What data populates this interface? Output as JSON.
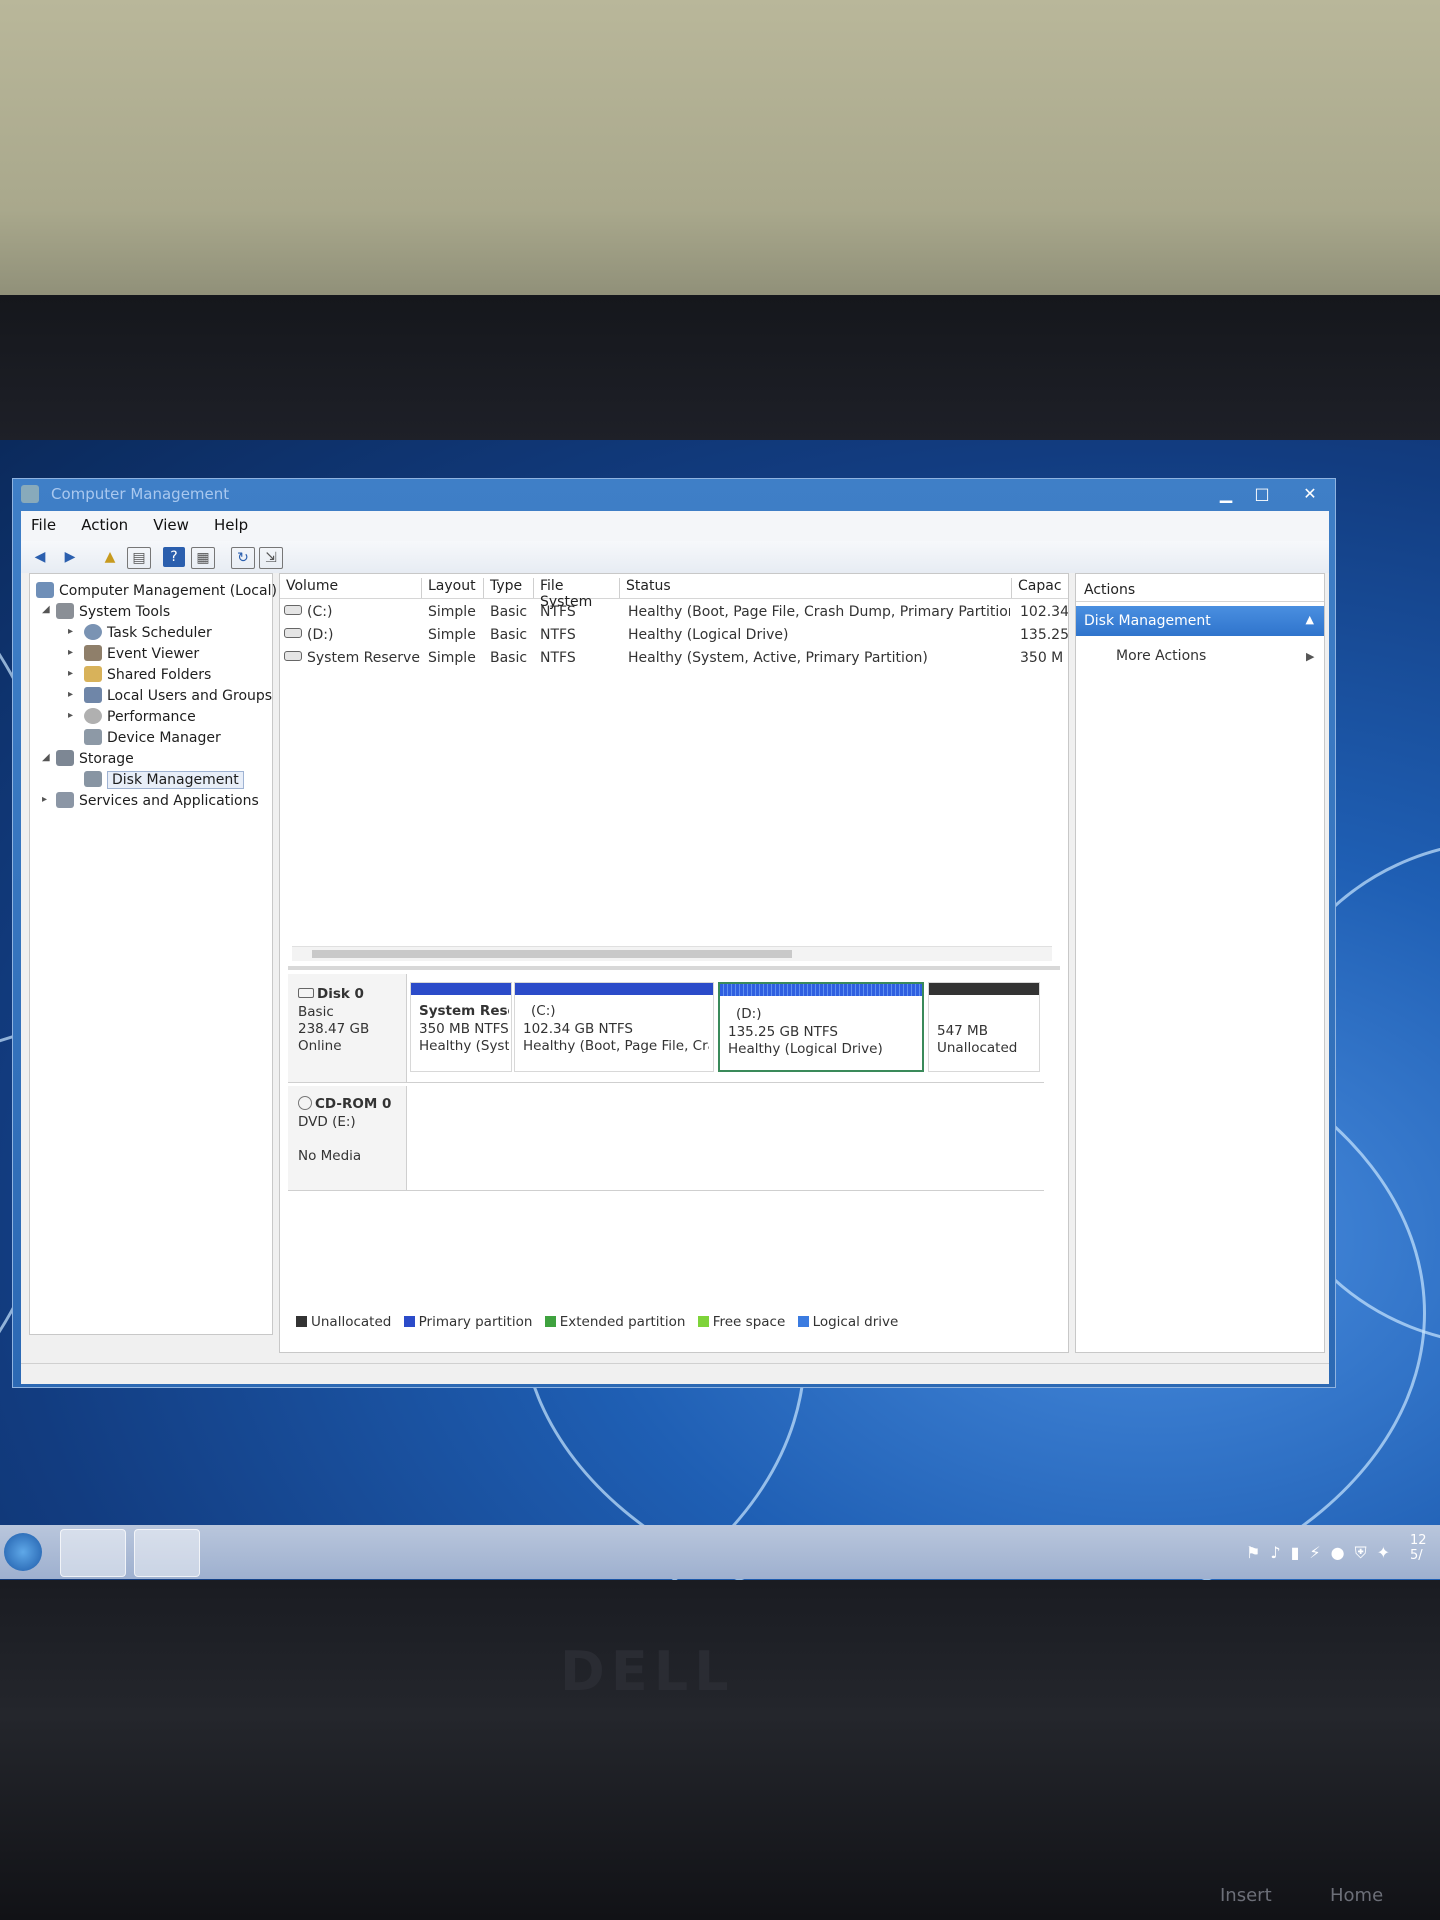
{
  "window": {
    "title": "Computer Management",
    "controls": {
      "minimize": "▁",
      "maximize": "□",
      "close": "✕"
    }
  },
  "menu": [
    "File",
    "Action",
    "View",
    "Help"
  ],
  "toolbar_icons": [
    "back-icon",
    "forward-icon",
    "up-icon",
    "show-hide-tree-icon",
    "help-icon",
    "properties-icon",
    "refresh-icon",
    "export-icon"
  ],
  "tree": {
    "root": "Computer Management (Local)",
    "system_tools": "System Tools",
    "task_scheduler": "Task Scheduler",
    "event_viewer": "Event Viewer",
    "shared_folders": "Shared Folders",
    "local_users": "Local Users and Groups",
    "performance": "Performance",
    "device_manager": "Device Manager",
    "storage": "Storage",
    "disk_management": "Disk Management",
    "services": "Services and Applications"
  },
  "volumes": {
    "headers": {
      "volume": "Volume",
      "layout": "Layout",
      "type": "Type",
      "fs": "File System",
      "status": "Status",
      "capacity": "Capac"
    },
    "rows": [
      {
        "volume": "(C:)",
        "layout": "Simple",
        "type": "Basic",
        "fs": "NTFS",
        "status": "Healthy (Boot, Page File, Crash Dump, Primary Partition)",
        "capacity": "102.34"
      },
      {
        "volume": "(D:)",
        "layout": "Simple",
        "type": "Basic",
        "fs": "NTFS",
        "status": "Healthy (Logical Drive)",
        "capacity": "135.25"
      },
      {
        "volume": "System Reserved",
        "layout": "Simple",
        "type": "Basic",
        "fs": "NTFS",
        "status": "Healthy (System, Active, Primary Partition)",
        "capacity": "350 M"
      }
    ]
  },
  "disk0": {
    "name": "Disk 0",
    "kind": "Basic",
    "size": "238.47 GB",
    "state": "Online",
    "partitions": [
      {
        "name": "System Rese",
        "size": "350 MB NTFS",
        "status": "Healthy (Syst"
      },
      {
        "name": "(C:)",
        "size": "102.34 GB NTFS",
        "status": "Healthy (Boot, Page File, Cra"
      },
      {
        "name": "(D:)",
        "size": "135.25 GB NTFS",
        "status": "Healthy (Logical Drive)"
      },
      {
        "name": "",
        "size": "547 MB",
        "status": "Unallocated"
      }
    ]
  },
  "cdrom": {
    "name": "CD-ROM 0",
    "drive": "DVD (E:)",
    "media": "No Media"
  },
  "legend": [
    "Unallocated",
    "Primary partition",
    "Extended partition",
    "Free space",
    "Logical drive"
  ],
  "legend_colors": [
    "#333333",
    "#2b4bc9",
    "#3fa23f",
    "#7ed33a",
    "#3b7be0"
  ],
  "actions": {
    "header": "Actions",
    "selected": "Disk Management",
    "more": "More Actions"
  },
  "laptop": {
    "brand": "DELL",
    "key_insert": "Insert",
    "key_home": "Home"
  },
  "taskbar": {
    "clock_line1": "12",
    "clock_line2": "5/"
  }
}
